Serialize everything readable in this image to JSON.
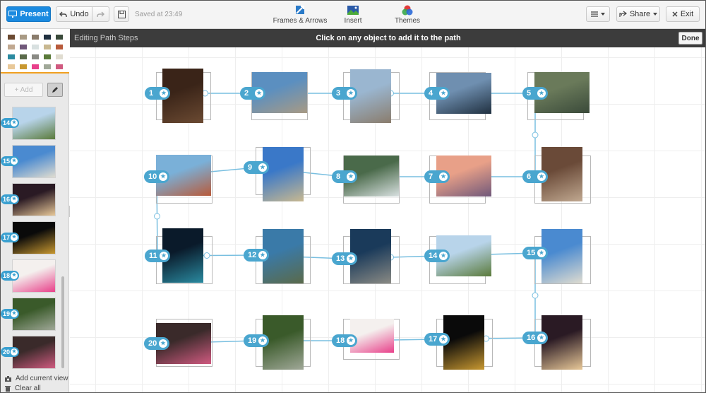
{
  "toolbar": {
    "present_label": "Present",
    "undo_label": "Undo",
    "saved_status": "Saved at 23:49",
    "tools": [
      {
        "label": "Frames & Arrows",
        "icon": "frames-arrows-icon"
      },
      {
        "label": "Insert",
        "icon": "insert-image-icon"
      },
      {
        "label": "Themes",
        "icon": "themes-icon"
      }
    ],
    "share_label": "Share",
    "exit_label": "Exit"
  },
  "path_bar": {
    "title": "Editing Path Steps",
    "hint": "Click on any object to add it to the path",
    "done_label": "Done"
  },
  "sidebar": {
    "add_label": "+ Add",
    "add_current_label": "Add current view",
    "clear_all_label": "Clear all",
    "thumbs": [
      {
        "n": "14",
        "subject": "harbor"
      },
      {
        "n": "15",
        "subject": "white-church"
      },
      {
        "n": "16",
        "subject": "ice-cream"
      },
      {
        "n": "17",
        "subject": "beer-bottle"
      },
      {
        "n": "18",
        "subject": "pink-flower"
      },
      {
        "n": "19",
        "subject": "forest-people"
      },
      {
        "n": "20",
        "subject": "sleeping-person"
      }
    ]
  },
  "colors": {
    "accent": "#1a8ae0",
    "path_line": "#79bfe0",
    "badge": "#4aa6cf",
    "pathbar": "#3c3c3c"
  },
  "steps": [
    {
      "n": "1",
      "subject": "carved-heart",
      "c1": "#3a2418",
      "c2": "#6b4a32"
    },
    {
      "n": "2",
      "subject": "lakeside-beach",
      "c1": "#5b8fc0",
      "c2": "#a89a84"
    },
    {
      "n": "3",
      "subject": "pebble-beach",
      "c1": "#9ab6d0",
      "c2": "#8a7c6c"
    },
    {
      "n": "4",
      "subject": "lake-mountains",
      "c1": "#6f8fb0",
      "c2": "#203040"
    },
    {
      "n": "5",
      "subject": "river-stream",
      "c1": "#6a7a5a",
      "c2": "#3a4a3a"
    },
    {
      "n": "6",
      "subject": "phone-booth",
      "c1": "#6a4a38",
      "c2": "#c0a890"
    },
    {
      "n": "7",
      "subject": "sunset-sea",
      "c1": "#e8a088",
      "c2": "#70587a"
    },
    {
      "n": "8",
      "subject": "waterfall",
      "c1": "#4a6a4a",
      "c2": "#d8e0e0"
    },
    {
      "n": "9",
      "subject": "bell-tower",
      "c1": "#3a78c8",
      "c2": "#c8b890"
    },
    {
      "n": "10",
      "subject": "old-town-roofs",
      "c1": "#7ab0d8",
      "c2": "#b85a3a"
    },
    {
      "n": "11",
      "subject": "led-grid",
      "c1": "#0a1a2a",
      "c2": "#2a8aa0"
    },
    {
      "n": "12",
      "subject": "sea-cliff",
      "c1": "#3a7aa8",
      "c2": "#5a6a4a"
    },
    {
      "n": "13",
      "subject": "rocky-shore",
      "c1": "#1a3a5a",
      "c2": "#8a8a84"
    },
    {
      "n": "14",
      "subject": "harbor",
      "c1": "#b8d4ea",
      "c2": "#5a7a3a"
    },
    {
      "n": "15",
      "subject": "white-church",
      "c1": "#4a8ad0",
      "c2": "#e0dcd0"
    },
    {
      "n": "16",
      "subject": "ice-cream",
      "c1": "#2a1a24",
      "c2": "#e8c898"
    },
    {
      "n": "17",
      "subject": "beer-bottle",
      "c1": "#0a0a0a",
      "c2": "#c89830"
    },
    {
      "n": "18",
      "subject": "pink-flower",
      "c1": "#f4f0ee",
      "c2": "#e8408a"
    },
    {
      "n": "19",
      "subject": "forest-people",
      "c1": "#3a5a2a",
      "c2": "#a0a898"
    },
    {
      "n": "20",
      "subject": "sleeping-person",
      "c1": "#3a2a2a",
      "c2": "#d05a80"
    }
  ]
}
